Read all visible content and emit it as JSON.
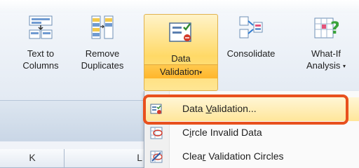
{
  "ribbon": {
    "text_to_columns": {
      "line1": "Text to",
      "line2": "Columns"
    },
    "remove_duplicates": {
      "line1": "Remove",
      "line2": "Duplicates"
    },
    "data_validation": {
      "line1": "Data",
      "line2": "Validation",
      "arrow": "▾"
    },
    "consolidate": {
      "line1": "Consolidate"
    },
    "what_if": {
      "line1": "What-If",
      "line2": "Analysis",
      "arrow": "▾"
    }
  },
  "menu": {
    "items": [
      {
        "pre": "Data ",
        "accel": "V",
        "post": "alidation...",
        "icon": "data-validation-icon",
        "highlighted": true
      },
      {
        "pre": "C",
        "accel": "i",
        "post": "rcle Invalid Data",
        "icon": "circle-invalid-data-icon",
        "highlighted": false
      },
      {
        "pre": "Clea",
        "accel": "r",
        "post": " Validation Circles",
        "icon": "clear-validation-circles-icon",
        "highlighted": false
      }
    ]
  },
  "grid": {
    "columns": [
      "K",
      "L"
    ]
  },
  "colors": {
    "highlight_border": "#e8501d",
    "dv_button_fill": "#ffd967"
  }
}
